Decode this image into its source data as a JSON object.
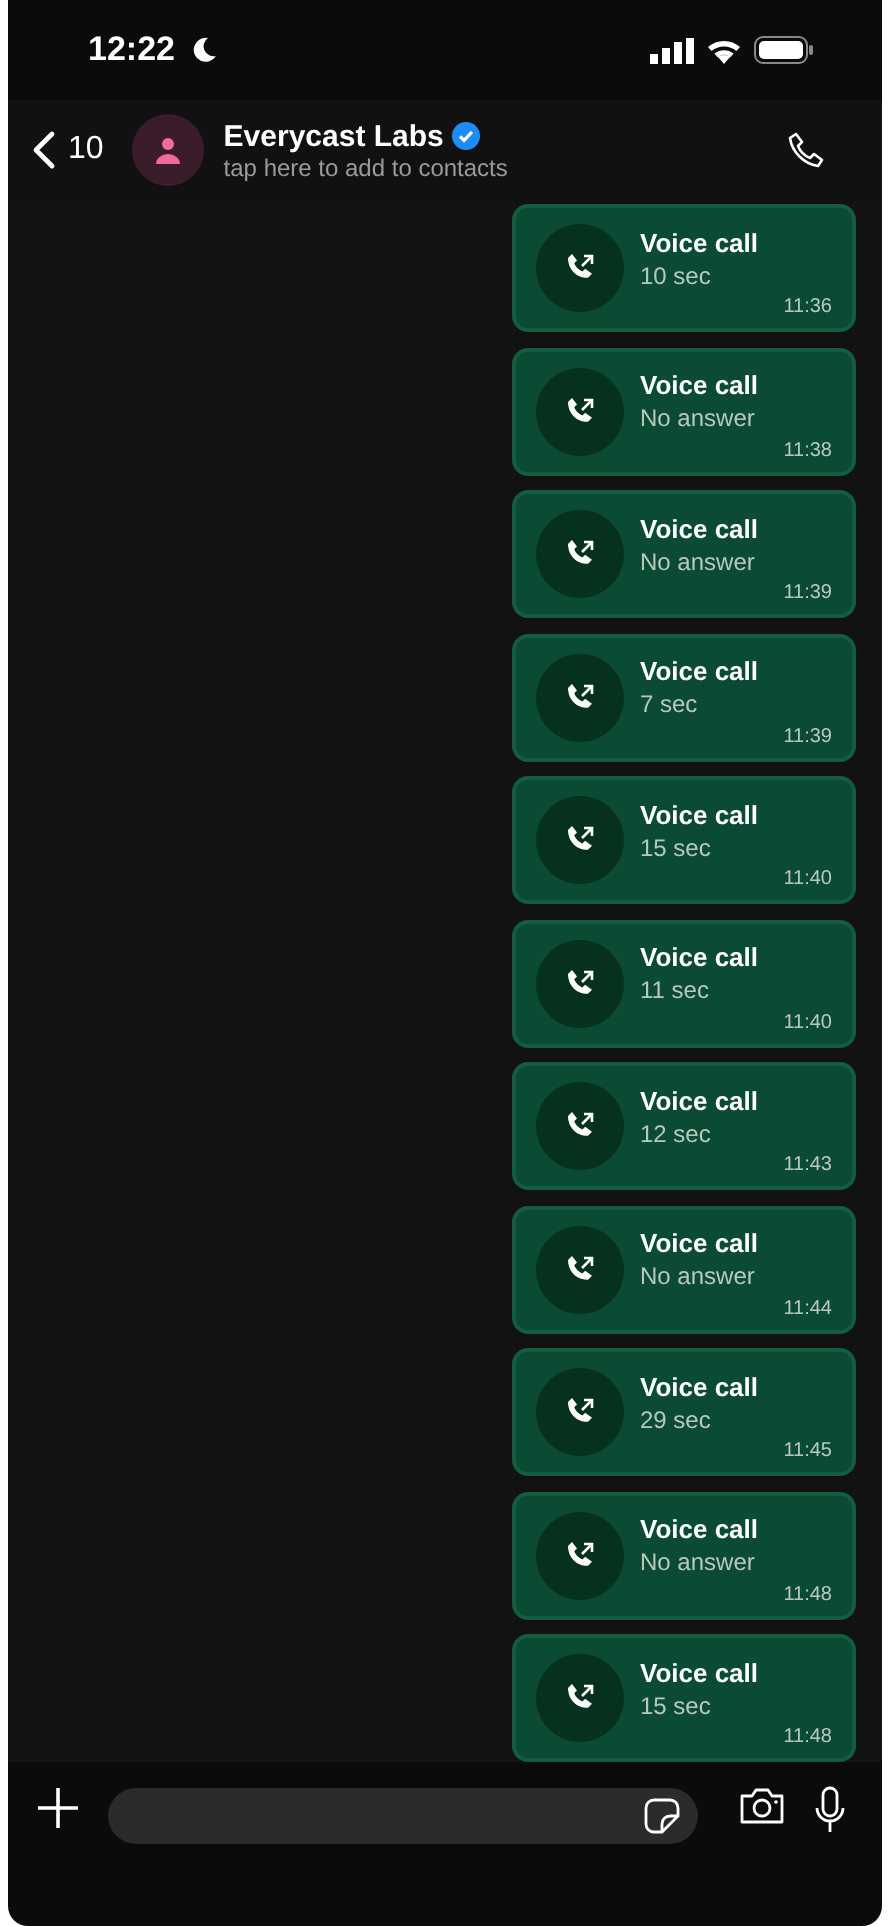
{
  "status_bar": {
    "time": "12:22"
  },
  "header": {
    "back_count": "10",
    "name": "Everycast Labs",
    "subtitle": "tap here to add to contacts",
    "verified": true
  },
  "messages": [
    {
      "title": "Voice call",
      "detail": "10 sec",
      "time": "11:36"
    },
    {
      "title": "Voice call",
      "detail": "No answer",
      "time": "11:38"
    },
    {
      "title": "Voice call",
      "detail": "No answer",
      "time": "11:39"
    },
    {
      "title": "Voice call",
      "detail": "7 sec",
      "time": "11:39"
    },
    {
      "title": "Voice call",
      "detail": "15 sec",
      "time": "11:40"
    },
    {
      "title": "Voice call",
      "detail": "11 sec",
      "time": "11:40"
    },
    {
      "title": "Voice call",
      "detail": "12 sec",
      "time": "11:43"
    },
    {
      "title": "Voice call",
      "detail": "No answer",
      "time": "11:44"
    },
    {
      "title": "Voice call",
      "detail": "29 sec",
      "time": "11:45"
    },
    {
      "title": "Voice call",
      "detail": "No answer",
      "time": "11:48"
    },
    {
      "title": "Voice call",
      "detail": "15 sec",
      "time": "11:48"
    }
  ]
}
